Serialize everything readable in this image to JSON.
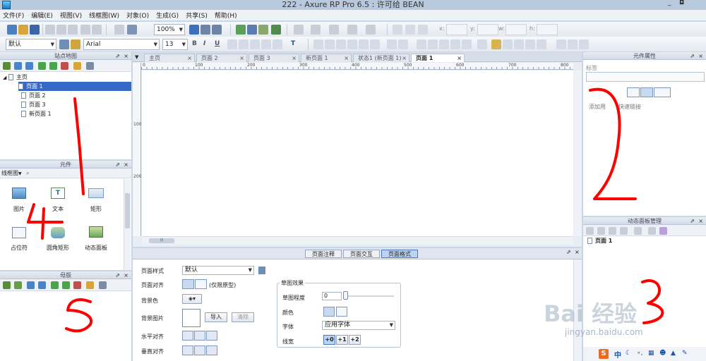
{
  "window": {
    "title": "222 - Axure RP Pro 6.5 : 许可给 BEAN",
    "minimize": "_",
    "restore": "◘"
  },
  "menu": [
    "文件(F)",
    "编辑(E)",
    "视图(V)",
    "线框图(W)",
    "对象(O)",
    "生成(G)",
    "共享(S)",
    "帮助(H)"
  ],
  "toolbar": {
    "zoom": "100%",
    "style_combo": "默认",
    "font_combo": "Arial",
    "size_combo": "13",
    "bold": "B",
    "italic": "I",
    "underline": "U",
    "text_color": "T",
    "x_label": "x:",
    "y_label": "y:",
    "w_label": "w:",
    "h_label": "h:"
  },
  "sitemap": {
    "title": "站点地图",
    "root": "主页",
    "pages": [
      "页面 1",
      "页面 2",
      "页面 3",
      "新页面 1"
    ],
    "selected": "页面 1"
  },
  "widgets": {
    "title": "元件",
    "library": "线框图",
    "items": [
      {
        "label": "图片",
        "icon": "image-icon"
      },
      {
        "label": "文本",
        "icon": "text-icon"
      },
      {
        "label": "矩形",
        "icon": "rectangle-icon"
      },
      {
        "label": "占位符",
        "icon": "placeholder-icon"
      },
      {
        "label": "圆角矩形",
        "icon": "rounded-rect-icon"
      },
      {
        "label": "动态面板",
        "icon": "dynamic-panel-icon"
      }
    ]
  },
  "masters": {
    "title": "母版"
  },
  "tabs": [
    "主页",
    "页面 2",
    "页面 3",
    "新页面 1",
    "状态1 (新页面 1)",
    "页面 1"
  ],
  "active_tab": "页面 1",
  "ruler": [
    "0",
    "100",
    "200",
    "300",
    "400",
    "500",
    "600",
    "700",
    "800"
  ],
  "ruler_v": [
    "100",
    "200"
  ],
  "page_props": {
    "tabs": [
      "页面注释",
      "页面交互",
      "页面格式"
    ],
    "active": "页面格式",
    "page_style_label": "页面样式",
    "page_style_value": "默认",
    "align_label": "页面对齐",
    "align_note": "(仅限原型)",
    "bg_color_label": "背景色",
    "bg_image_label": "背景图片",
    "import_btn": "导入",
    "clear_btn": "清除",
    "h_align_label": "水平对齐",
    "v_align_label": "垂直对齐",
    "sketch_title": "草图效果",
    "sketch_level_label": "草图程度",
    "sketch_level_value": "0",
    "color_label": "颜色",
    "font_label": "字体",
    "font_value": "应用字体",
    "line_width_label": "线宽",
    "line_widths": [
      "+0",
      "+1",
      "+2"
    ]
  },
  "widget_props": {
    "title": "元件属性",
    "label_field": "标签",
    "add_use": "添加用",
    "quick_link": "快速链接"
  },
  "dyn_panel": {
    "title": "动态面板管理",
    "item": "页面 1"
  },
  "annotations": [
    "1",
    "2",
    "3",
    "4",
    "5"
  ],
  "watermark": {
    "text": "Bai 经验",
    "url": "jingyan.baidu.com"
  },
  "tray": {
    "ime": "中",
    "ime_brand": "S"
  },
  "colors": {
    "accent": "#3a78d1",
    "selection": "#3569c8",
    "annotation": "#ff0000"
  }
}
